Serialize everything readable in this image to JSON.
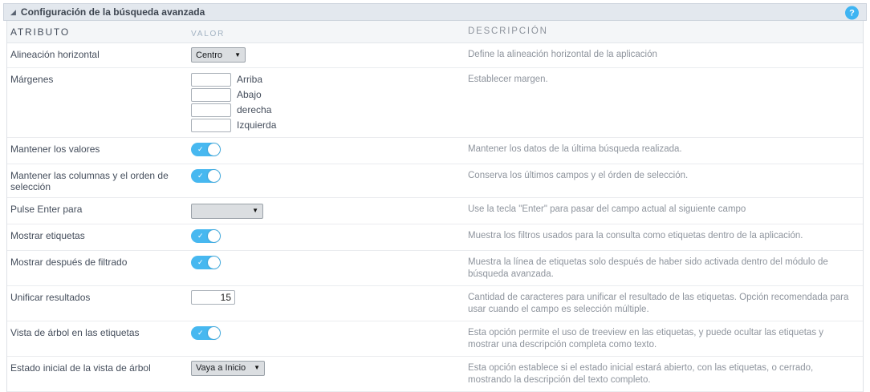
{
  "panel": {
    "title": "Configuración de la búsqueda avanzada",
    "collapse_icon": "◢",
    "help_icon_label": "?"
  },
  "table": {
    "headers": {
      "attribute": "ATRIBUTO",
      "value": "VALOR",
      "description": "DESCRIPCIÓN"
    }
  },
  "colors": {
    "accent_toggle": "#47b8f0",
    "help_icon": "#3eb4f2",
    "header_bg": "#e3e8ee"
  },
  "rows": [
    {
      "id": "horizontal-alignment",
      "attribute": "Alineación horizontal",
      "control": {
        "type": "select",
        "value": "Centro"
      },
      "description": "Define la alineación horizontal de la aplicación"
    },
    {
      "id": "margins",
      "attribute": "Márgenes",
      "control": {
        "type": "margin-inputs",
        "inputs": [
          {
            "label": "Arriba",
            "value": ""
          },
          {
            "label": "Abajo",
            "value": ""
          },
          {
            "label": "derecha",
            "value": ""
          },
          {
            "label": "Izquierda",
            "value": ""
          }
        ]
      },
      "description": "Establecer margen."
    },
    {
      "id": "keep-values",
      "attribute": "Mantener los valores",
      "control": {
        "type": "toggle",
        "checked": true
      },
      "description": "Mantener los datos de la última búsqueda realizada."
    },
    {
      "id": "keep-columns-order",
      "attribute": "Mantener las columnas y el orden de selección",
      "control": {
        "type": "toggle",
        "checked": true
      },
      "description": "Conserva los últimos campos y el órden de selección."
    },
    {
      "id": "press-enter-to",
      "attribute": "Pulse Enter para",
      "control": {
        "type": "select",
        "value": ""
      },
      "description": "Use la tecla \"Enter\" para pasar del campo actual al siguiente campo"
    },
    {
      "id": "show-tags",
      "attribute": "Mostrar etiquetas",
      "control": {
        "type": "toggle",
        "checked": true
      },
      "description": "Muestra los filtros usados para la consulta como etiquetas dentro de la aplicación."
    },
    {
      "id": "show-after-filtering",
      "attribute": "Mostrar después de filtrado",
      "control": {
        "type": "toggle",
        "checked": true
      },
      "description": "Muestra la línea de etiquetas solo después de haber sido activada dentro del módulo de búsqueda avanzada."
    },
    {
      "id": "unify-results",
      "attribute": "Unificar resultados",
      "control": {
        "type": "input",
        "value": "15"
      },
      "description": "Cantidad de caracteres para unificar el resultado de las etiquetas. Opción recomendada para usar cuando el campo es selección múltiple."
    },
    {
      "id": "treeview-tags",
      "attribute": "Vista de árbol en las etiquetas",
      "control": {
        "type": "toggle",
        "checked": true
      },
      "description": "Esta opción permite el uso de treeview en las etiquetas, y puede ocultar las etiquetas y mostrar una descripción completa como texto."
    },
    {
      "id": "treeview-initial-state",
      "attribute": "Estado inicial de la vista de árbol",
      "control": {
        "type": "select",
        "value": "Vaya a Inicio"
      },
      "description": "Esta opción establece si el estado inicial estará abierto, con las etiquetas, o cerrado, mostrando la descripción del texto completo."
    }
  ]
}
